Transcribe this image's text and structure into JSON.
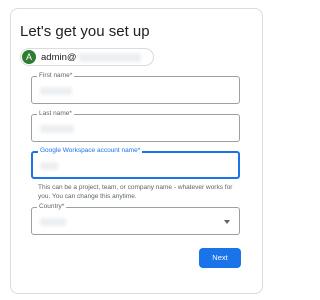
{
  "page": {
    "title": "Let's get you set up"
  },
  "account": {
    "avatar_letter": "A",
    "email_prefix": "admin@"
  },
  "form": {
    "first_name_label": "First name*",
    "last_name_label": "Last name*",
    "workspace_label": "Google Workspace account name*",
    "workspace_helper": "This can be a project, team, or company name - whatever works for you. You can change this anytime.",
    "country_label": "Country*"
  },
  "actions": {
    "next_label": "Next"
  },
  "colors": {
    "primary": "#1a73e8",
    "avatar": "#2e7d32",
    "border": "#9aa0a6"
  }
}
